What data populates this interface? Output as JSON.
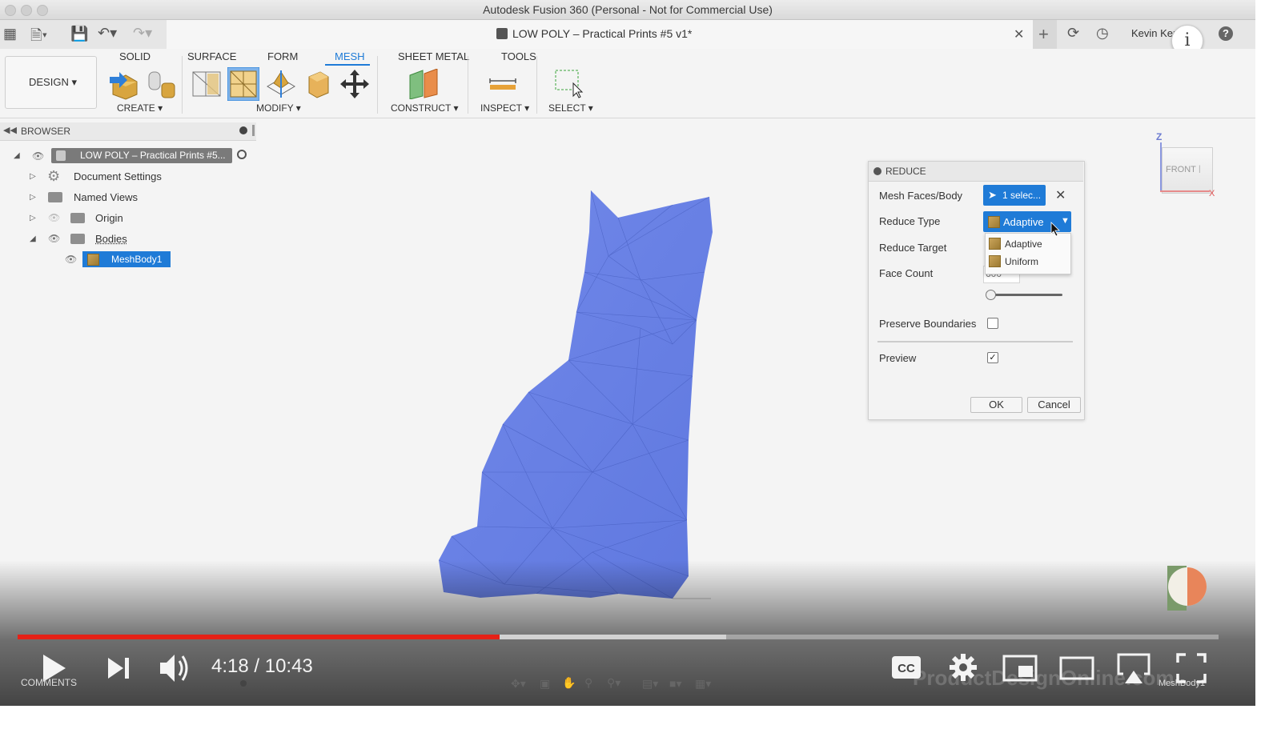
{
  "window": {
    "title": "Autodesk Fusion 360 (Personal - Not for Commercial Use)"
  },
  "document": {
    "title": "LOW POLY – Practical Prints #5 v1*",
    "user": "Kevin Ker"
  },
  "ribbon": {
    "workspace": "DESIGN",
    "tabs": [
      "SOLID",
      "SURFACE",
      "FORM",
      "MESH",
      "SHEET METAL",
      "TOOLS"
    ],
    "active_tab": "MESH",
    "groups": {
      "create": "CREATE",
      "modify": "MODIFY",
      "construct": "CONSTRUCT",
      "inspect": "INSPECT",
      "select": "SELECT"
    }
  },
  "browser": {
    "title": "BROWSER",
    "root": "LOW POLY – Practical Prints #5...",
    "items": [
      "Document Settings",
      "Named Views",
      "Origin",
      "Bodies"
    ],
    "body": "MeshBody1"
  },
  "reduce_panel": {
    "title": "REDUCE",
    "mesh_faces_label": "Mesh Faces/Body",
    "selection": "1 selec...",
    "reduce_type_label": "Reduce Type",
    "reduce_type_value": "Adaptive",
    "reduce_target_label": "Reduce Target",
    "options": [
      "Adaptive",
      "Uniform"
    ],
    "face_count_label": "Face Count",
    "face_count_value": "600",
    "face_count_slider_level": 0.02,
    "preserve_boundaries_label": "Preserve Boundaries",
    "preserve_boundaries": false,
    "preview_label": "Preview",
    "preview": true,
    "ok": "OK",
    "cancel": "Cancel"
  },
  "viewcube": {
    "face": "FRONT",
    "axis_z": "Z",
    "axis_x": "X"
  },
  "video": {
    "time": "4:18 / 10:43",
    "progress": 0.401,
    "buffered": 0.59,
    "comments_label": "COMMENTS",
    "watermark": "ProductDesignOnline.com",
    "status_body": "MeshBody1"
  },
  "colors": {
    "accent": "#1f7bd7",
    "model": "#6f86e6",
    "progress": "#e62117"
  }
}
